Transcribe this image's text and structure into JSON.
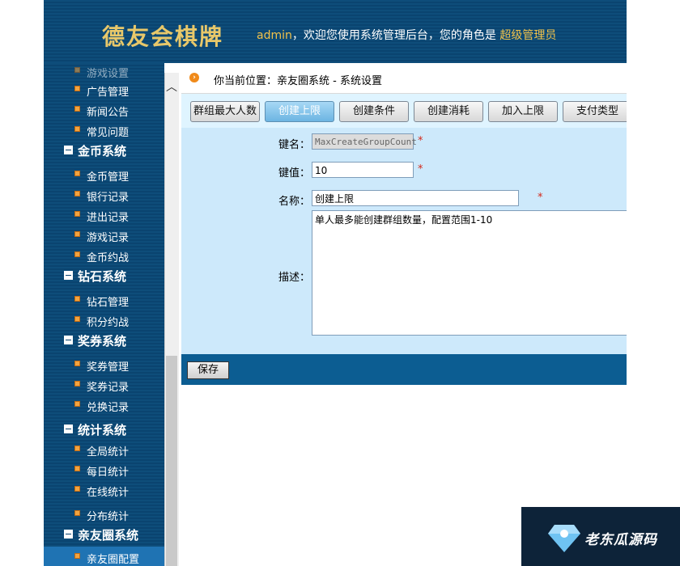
{
  "header": {
    "logo": "德友会棋牌",
    "user": "admin",
    "welcome_text": "，欢迎您使用系统管理后台，您的角色是",
    "role": "超级管理员"
  },
  "sidebar": {
    "partial_top": "游戏设置",
    "items": [
      {
        "type": "item",
        "label": "广告管理"
      },
      {
        "type": "item",
        "label": "新闻公告"
      },
      {
        "type": "item",
        "label": "常见问题"
      },
      {
        "type": "group",
        "label": "金币系统"
      },
      {
        "type": "item",
        "label": "金币管理"
      },
      {
        "type": "item",
        "label": "银行记录"
      },
      {
        "type": "item",
        "label": "进出记录"
      },
      {
        "type": "item",
        "label": "游戏记录"
      },
      {
        "type": "item",
        "label": "金币约战"
      },
      {
        "type": "group",
        "label": "钻石系统"
      },
      {
        "type": "item",
        "label": "钻石管理"
      },
      {
        "type": "item",
        "label": "积分约战"
      },
      {
        "type": "group",
        "label": "奖券系统"
      },
      {
        "type": "item",
        "label": "奖券管理"
      },
      {
        "type": "item",
        "label": "奖券记录"
      },
      {
        "type": "item",
        "label": "兑换记录"
      },
      {
        "type": "group",
        "label": "统计系统"
      },
      {
        "type": "item",
        "label": "全局统计"
      },
      {
        "type": "item",
        "label": "每日统计"
      },
      {
        "type": "item",
        "label": "在线统计"
      },
      {
        "type": "item",
        "label": "分布统计"
      },
      {
        "type": "group",
        "label": "亲友圈系统"
      },
      {
        "type": "item",
        "label": "亲友圈配置",
        "active": true
      }
    ]
  },
  "breadcrumb": {
    "text": "你当前位置：亲友圈系统 - 系统设置"
  },
  "tabs": [
    "群组最大人数",
    "创建上限",
    "创建条件",
    "创建消耗",
    "加入上限",
    "支付类型"
  ],
  "active_tab": "创建上限",
  "form": {
    "key_label": "键名：",
    "key_value": "MaxCreateGroupCount",
    "value_label": "键值：",
    "value_value": "10",
    "name_label": "名称：",
    "name_value": "创建上限",
    "desc_label": "描述：",
    "desc_value": "单人最多能创建群组数量，配置范围1-10",
    "required_mark": "*"
  },
  "footer": {
    "save_label": "保存"
  },
  "watermark": {
    "text": "老东瓜源码"
  },
  "colors": {
    "nav_bg": "#0a4470",
    "form_bg": "#cde9fb",
    "tab_bar_bg": "#dff4ff",
    "footer_bg": "#0c5d92",
    "accent_gold": "#f2c24a",
    "required_red": "#d4291a"
  }
}
